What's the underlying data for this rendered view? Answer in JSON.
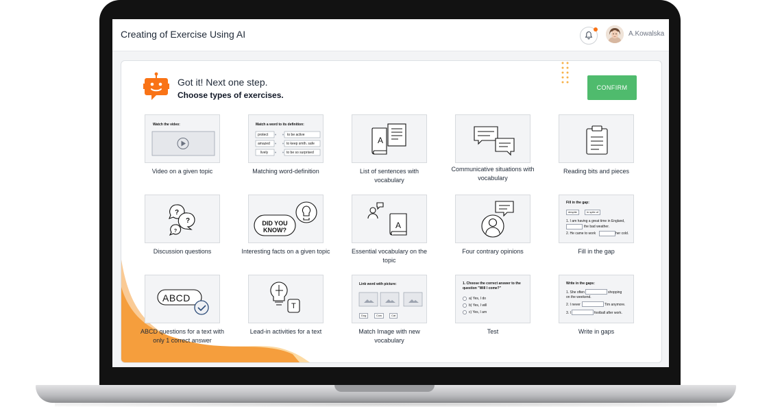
{
  "header": {
    "title": "Creating of Exercise Using AI",
    "username": "A.Kowalska"
  },
  "intro": {
    "title": "Got it! Next one step.",
    "subtitle": "Choose types of exercises."
  },
  "confirm_label": "CONFIRM",
  "colors": {
    "accent": "#4fbb6d",
    "robot": "#f97316",
    "wave": "#f59e3d"
  },
  "exercises": [
    {
      "label": "Video on a given topic",
      "icon": "video-player",
      "preview": {
        "heading": "Watch the video:"
      }
    },
    {
      "label": "Matching word-definition",
      "icon": "matching",
      "preview": {
        "heading": "Match a word to its definition:",
        "words": [
          "protect",
          "amazed",
          "lively"
        ],
        "definitions": [
          "to be active",
          "to keep smth. safe",
          "to be so surprised"
        ]
      }
    },
    {
      "label": "List of sentences with vocabulary",
      "icon": "books"
    },
    {
      "label": "Communicative situations with vocabulary",
      "icon": "chat-bubbles"
    },
    {
      "label": "Reading bits and pieces",
      "icon": "clipboard"
    },
    {
      "label": "Discussion questions",
      "icon": "question-bubbles"
    },
    {
      "label": "Interesting facts on a given topic",
      "icon": "lightbulb",
      "preview": {
        "bubble": "DID YOU KNOW?"
      }
    },
    {
      "label": "Essential vocabulary on the topic",
      "icon": "person-book"
    },
    {
      "label": "Four contrary opinions",
      "icon": "person-speech"
    },
    {
      "label": "Fill in the gap",
      "icon": "fill-gap",
      "preview": {
        "heading": "Fill in the gap:",
        "options": [
          "despite",
          "in spite of"
        ],
        "lines": [
          "1. I am having a great time in England,",
          "the bad weather.",
          "2. He came to work",
          "her cold."
        ]
      }
    },
    {
      "label": "ABCD questions for a text with only 1 correct answer",
      "icon": "abcd-check",
      "preview": {
        "text": "ABCD"
      }
    },
    {
      "label": "Lead-in activities for a text",
      "icon": "puzzle-bulb",
      "preview": {
        "letter": "T"
      }
    },
    {
      "label": "Match Image with new vocabulary",
      "icon": "image-match",
      "preview": {
        "heading": "Link word with picture:",
        "words": [
          "Dog",
          "Cow",
          "Cat"
        ]
      }
    },
    {
      "label": "Test",
      "icon": "test-radio",
      "preview": {
        "question": "1. Choose the correct answer to the question \"Will I come?\"",
        "answers": [
          "a) Yes, I do",
          "b) Yes, I will",
          "c) Yes, I am"
        ]
      }
    },
    {
      "label": "Write in gaps",
      "icon": "write-gaps",
      "preview": {
        "heading": "Write in the gaps:",
        "lines": [
          "1. She often",
          "shopping",
          "on the weekend.",
          "2. I never",
          "Tim anymore.",
          "3. I",
          "football after work."
        ]
      }
    }
  ]
}
